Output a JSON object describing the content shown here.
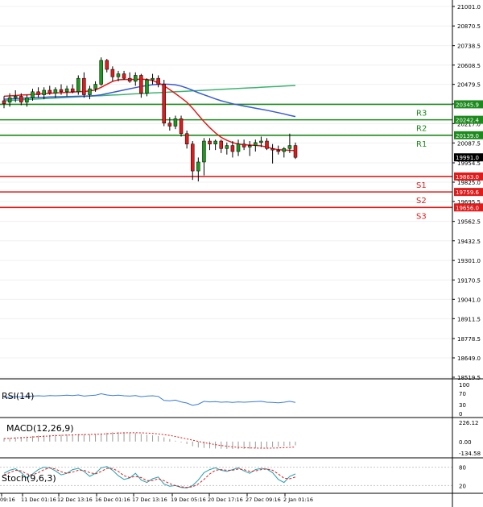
{
  "chart_data": {
    "type": "candlestick",
    "price_axis": {
      "min": 18519.5,
      "max": 21001.0,
      "ticks": [
        "21001.0",
        "20870.5",
        "20738.5",
        "20608.5",
        "20479.5",
        "20348.5",
        "20217.0",
        "20087.5",
        "19954.5",
        "19825.0",
        "19695.5",
        "19562.5",
        "19432.5",
        "19301.0",
        "19170.5",
        "19041.0",
        "18911.5",
        "18778.5",
        "18649.0",
        "18519.5"
      ]
    },
    "time_labels": [
      "09:16",
      "11 Dec 01:16",
      "12 Dec 13:16",
      "16 Dec 01:16",
      "17 Dec 13:16",
      "19 Dec 05:16",
      "20 Dec 17:16",
      "27 Dec 09:16",
      "2 Jan 01:16"
    ],
    "current_price": {
      "label": "19991.0",
      "value": 19991.0
    },
    "levels": [
      {
        "name": "R3",
        "value": 20345.9,
        "label": "20345.9",
        "color": "#1c8a1c"
      },
      {
        "name": "R2",
        "value": 20242.4,
        "label": "20242.4",
        "color": "#1c8a1c"
      },
      {
        "name": "R1",
        "value": 20139.0,
        "label": "20139.0",
        "color": "#1c8a1c"
      },
      {
        "name": "S1",
        "value": 19863.0,
        "label": "19863.0",
        "color": "#e01b1b"
      },
      {
        "name": "S2",
        "value": 19759.6,
        "label": "19759.6",
        "color": "#e01b1b"
      },
      {
        "name": "S3",
        "value": 19656.0,
        "label": "19656.0",
        "color": "#e01b1b"
      }
    ],
    "candles": [
      {
        "o": 20370,
        "h": 20400,
        "l": 20320,
        "c": 20350
      },
      {
        "o": 20360,
        "h": 20420,
        "l": 20330,
        "c": 20390
      },
      {
        "o": 20390,
        "h": 20440,
        "l": 20360,
        "c": 20400
      },
      {
        "o": 20400,
        "h": 20420,
        "l": 20340,
        "c": 20360
      },
      {
        "o": 20360,
        "h": 20410,
        "l": 20330,
        "c": 20390
      },
      {
        "o": 20390,
        "h": 20450,
        "l": 20370,
        "c": 20430
      },
      {
        "o": 20430,
        "h": 20460,
        "l": 20390,
        "c": 20410
      },
      {
        "o": 20410,
        "h": 20460,
        "l": 20380,
        "c": 20440
      },
      {
        "o": 20440,
        "h": 20470,
        "l": 20410,
        "c": 20420
      },
      {
        "o": 20420,
        "h": 20460,
        "l": 20390,
        "c": 20445
      },
      {
        "o": 20445,
        "h": 20480,
        "l": 20410,
        "c": 20430
      },
      {
        "o": 20430,
        "h": 20470,
        "l": 20400,
        "c": 20450
      },
      {
        "o": 20450,
        "h": 20480,
        "l": 20420,
        "c": 20430
      },
      {
        "o": 20430,
        "h": 20540,
        "l": 20410,
        "c": 20520
      },
      {
        "o": 20520,
        "h": 20560,
        "l": 20390,
        "c": 20410
      },
      {
        "o": 20410,
        "h": 20470,
        "l": 20380,
        "c": 20450
      },
      {
        "o": 20450,
        "h": 20500,
        "l": 20430,
        "c": 20480
      },
      {
        "o": 20480,
        "h": 20660,
        "l": 20470,
        "c": 20640
      },
      {
        "o": 20640,
        "h": 20650,
        "l": 20560,
        "c": 20580
      },
      {
        "o": 20580,
        "h": 20600,
        "l": 20500,
        "c": 20530
      },
      {
        "o": 20530,
        "h": 20570,
        "l": 20500,
        "c": 20550
      },
      {
        "o": 20550,
        "h": 20570,
        "l": 20510,
        "c": 20520
      },
      {
        "o": 20520,
        "h": 20560,
        "l": 20490,
        "c": 20500
      },
      {
        "o": 20500,
        "h": 20560,
        "l": 20470,
        "c": 20540
      },
      {
        "o": 20540,
        "h": 20550,
        "l": 20390,
        "c": 20420
      },
      {
        "o": 20420,
        "h": 20520,
        "l": 20400,
        "c": 20510
      },
      {
        "o": 20510,
        "h": 20550,
        "l": 20480,
        "c": 20520
      },
      {
        "o": 20520,
        "h": 20540,
        "l": 20460,
        "c": 20480
      },
      {
        "o": 20480,
        "h": 20510,
        "l": 20200,
        "c": 20220
      },
      {
        "o": 20220,
        "h": 20260,
        "l": 20170,
        "c": 20200
      },
      {
        "o": 20200,
        "h": 20270,
        "l": 20180,
        "c": 20250
      },
      {
        "o": 20250,
        "h": 20270,
        "l": 20130,
        "c": 20150
      },
      {
        "o": 20150,
        "h": 20170,
        "l": 20050,
        "c": 20080
      },
      {
        "o": 20080,
        "h": 20100,
        "l": 19840,
        "c": 19900
      },
      {
        "o": 19900,
        "h": 19990,
        "l": 19830,
        "c": 19960
      },
      {
        "o": 19960,
        "h": 20120,
        "l": 19870,
        "c": 20100
      },
      {
        "o": 20100,
        "h": 20120,
        "l": 20040,
        "c": 20080
      },
      {
        "o": 20080,
        "h": 20110,
        "l": 20040,
        "c": 20100
      },
      {
        "o": 20100,
        "h": 20110,
        "l": 20020,
        "c": 20050
      },
      {
        "o": 20050,
        "h": 20090,
        "l": 20010,
        "c": 20070
      },
      {
        "o": 20070,
        "h": 20100,
        "l": 19990,
        "c": 20030
      },
      {
        "o": 20030,
        "h": 20110,
        "l": 20000,
        "c": 20080
      },
      {
        "o": 20080,
        "h": 20110,
        "l": 20040,
        "c": 20060
      },
      {
        "o": 20060,
        "h": 20100,
        "l": 20000,
        "c": 20070
      },
      {
        "o": 20070,
        "h": 20110,
        "l": 20030,
        "c": 20090
      },
      {
        "o": 20090,
        "h": 20130,
        "l": 20060,
        "c": 20100
      },
      {
        "o": 20100,
        "h": 20120,
        "l": 20040,
        "c": 20050
      },
      {
        "o": 20050,
        "h": 20080,
        "l": 19950,
        "c": 20040
      },
      {
        "o": 20040,
        "h": 20070,
        "l": 20010,
        "c": 20030
      },
      {
        "o": 20030,
        "h": 20060,
        "l": 19990,
        "c": 20050
      },
      {
        "o": 20050,
        "h": 20150,
        "l": 20020,
        "c": 20070
      },
      {
        "o": 20070,
        "h": 20090,
        "l": 19980,
        "c": 19991
      }
    ],
    "ma_red": [
      20400,
      20402,
      20405,
      20408,
      20410,
      20412,
      20415,
      20418,
      20420,
      20422,
      20424,
      20426,
      20428,
      20430,
      20432,
      20436,
      20442,
      20460,
      20480,
      20500,
      20510,
      20512,
      20512,
      20513,
      20514,
      20512,
      20505,
      20490,
      20470,
      20445,
      20418,
      20390,
      20360,
      20320,
      20275,
      20230,
      20190,
      20155,
      20125,
      20105,
      20090,
      20080,
      20076,
      20073,
      20071,
      20068,
      20060,
      20050,
      20042,
      20040,
      20038,
      20036
    ],
    "ma_blue": [
      20380,
      20382,
      20384,
      20386,
      20388,
      20390,
      20392,
      20393,
      20395,
      20396,
      20397,
      20398,
      20399,
      20400,
      20401,
      20402,
      20405,
      20410,
      20418,
      20426,
      20434,
      20442,
      20450,
      20458,
      20466,
      20472,
      20477,
      20480,
      20481,
      20480,
      20476,
      20468,
      20455,
      20440,
      20424,
      20410,
      20396,
      20382,
      20370,
      20360,
      20350,
      20342,
      20334,
      20327,
      20320,
      20313,
      20306,
      20298,
      20290,
      20282,
      20272,
      20264
    ],
    "ma_green": [
      20370,
      20372,
      20374,
      20376,
      20378,
      20380,
      20382,
      20384,
      20386,
      20388,
      20390,
      20392,
      20394,
      20396,
      20398,
      20400,
      20402,
      20404,
      20406,
      20408,
      20410,
      20412,
      20414,
      20416,
      20418,
      20420,
      20422,
      20424,
      20426,
      20428,
      20430,
      20432,
      20434,
      20436,
      20438,
      20440,
      20442,
      20444,
      20446,
      20448,
      20450,
      20452,
      20454,
      20456,
      20458,
      20460,
      20462,
      20464,
      20466,
      20468,
      20470,
      20472
    ],
    "rsi": {
      "label": "RSI(14)",
      "ticks": [
        "100",
        "70",
        "30",
        "0"
      ],
      "values": [
        55,
        56,
        58,
        57,
        59,
        60,
        61,
        60,
        62,
        61,
        62,
        63,
        62,
        64,
        60,
        62,
        63,
        68,
        64,
        62,
        63,
        61,
        60,
        62,
        58,
        60,
        61,
        59,
        45,
        44,
        46,
        40,
        36,
        28,
        32,
        42,
        40,
        41,
        39,
        40,
        38,
        40,
        39,
        40,
        41,
        42,
        39,
        38,
        37,
        39,
        42,
        38
      ]
    },
    "macd": {
      "label": "MACD(12,26,9)",
      "ticks": [
        "226.12",
        "0.00",
        "-134.58"
      ],
      "histogram": [
        40,
        45,
        50,
        55,
        60,
        65,
        70,
        75,
        78,
        80,
        82,
        84,
        86,
        88,
        88,
        86,
        88,
        96,
        104,
        110,
        112,
        110,
        106,
        100,
        90,
        82,
        74,
        66,
        50,
        30,
        10,
        -10,
        -30,
        -55,
        -70,
        -75,
        -80,
        -82,
        -84,
        -86,
        -88,
        -88,
        -86,
        -84,
        -80,
        -76,
        -72,
        -66,
        -60,
        -54,
        -48,
        -44
      ],
      "signal": [
        35,
        38,
        42,
        46,
        50,
        54,
        58,
        62,
        66,
        70,
        73,
        76,
        78,
        80,
        82,
        84,
        86,
        88,
        92,
        96,
        100,
        103,
        104,
        104,
        103,
        100,
        96,
        90,
        82,
        72,
        60,
        46,
        32,
        16,
        2,
        -12,
        -24,
        -36,
        -46,
        -55,
        -62,
        -68,
        -72,
        -75,
        -77,
        -78,
        -78,
        -77,
        -75,
        -72,
        -68,
        -64
      ]
    },
    "stoch": {
      "label": "Stoch(9,6,3)",
      "ticks": [
        "80",
        "20"
      ],
      "k": [
        60,
        70,
        75,
        62,
        45,
        58,
        72,
        80,
        78,
        68,
        55,
        60,
        72,
        76,
        66,
        50,
        60,
        78,
        82,
        70,
        52,
        40,
        45,
        60,
        38,
        30,
        42,
        48,
        25,
        18,
        20,
        14,
        12,
        20,
        38,
        62,
        72,
        78,
        70,
        66,
        72,
        78,
        68,
        60,
        72,
        76,
        74,
        62,
        40,
        30,
        50,
        58
      ],
      "d": [
        55,
        62,
        70,
        68,
        58,
        55,
        62,
        72,
        78,
        74,
        65,
        60,
        64,
        70,
        70,
        62,
        58,
        66,
        76,
        76,
        66,
        52,
        46,
        50,
        46,
        36,
        36,
        42,
        36,
        26,
        20,
        16,
        14,
        16,
        25,
        40,
        58,
        70,
        72,
        70,
        70,
        74,
        72,
        66,
        68,
        72,
        74,
        70,
        58,
        44,
        42,
        48
      ]
    }
  }
}
